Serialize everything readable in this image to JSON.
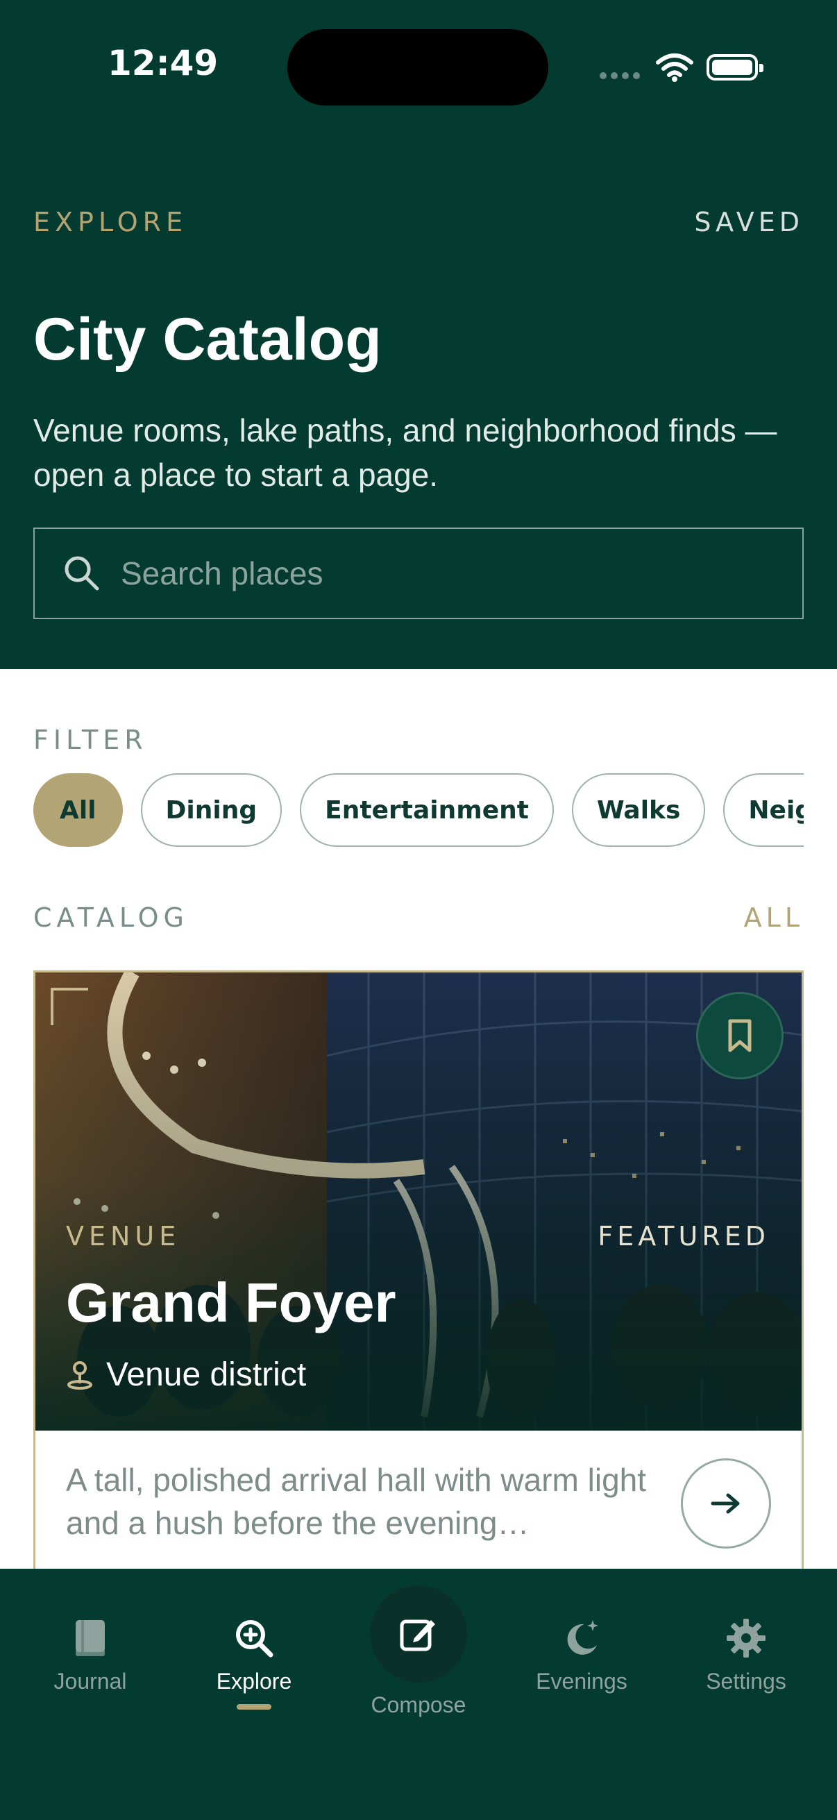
{
  "status": {
    "time": "12:49"
  },
  "header": {
    "eyebrow": "EXPLORE",
    "saved": "SAVED",
    "title": "City Catalog",
    "subtitle": "Venue rooms, lake paths, and neighborhood finds — open a place to start a page."
  },
  "search": {
    "placeholder": "Search places",
    "value": ""
  },
  "filter": {
    "label": "FILTER",
    "chips": [
      "All",
      "Dining",
      "Entertainment",
      "Walks",
      "Neighborh"
    ],
    "selected": "All"
  },
  "catalog": {
    "label": "CATALOG",
    "all": "ALL"
  },
  "card": {
    "kind": "VENUE",
    "badge": "FEATURED",
    "title": "Grand Foyer",
    "location": "Venue district",
    "description": "A tall, polished arrival hall with warm light and a hush before the evening…"
  },
  "tabs": {
    "journal": "Journal",
    "explore": "Explore",
    "compose": "Compose",
    "evenings": "Evenings",
    "settings": "Settings",
    "active": "Explore"
  },
  "colors": {
    "header_bg": "#043b30",
    "accent_gold": "#b3a475",
    "text_dark": "#0f3a31"
  },
  "icons": [
    "search-icon",
    "wifi-icon",
    "battery-icon",
    "bookmark-icon",
    "location-pin-icon",
    "arrow-right-icon",
    "book-icon",
    "explore-icon",
    "compose-icon",
    "moon-icon",
    "gear-icon"
  ]
}
